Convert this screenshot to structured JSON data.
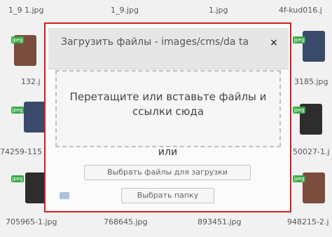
{
  "background": {
    "filenames": [
      "1_9 1.jpg",
      "1_9.jpg",
      "1.jpg",
      "4f-kud016.j",
      "132.j",
      "3185.jpg",
      "74259-115",
      "50027-1.j",
      "705965-1.jpg",
      "768645.jpg",
      "893451.jpg",
      "948215-2.j"
    ],
    "tag_label": "jpeg"
  },
  "dialog": {
    "title": "Загрузить файлы - images/cms/da ta",
    "close_glyph": "×",
    "drop_text": "Перетащите или вставьте файлы и ссылки сюда",
    "or_text": "или",
    "choose_files_label": "Выбрать файлы для загрузки",
    "choose_folder_label": "Выбрать папку"
  },
  "colors": {
    "highlight_border": "#d11f1f",
    "tag_green": "#3aa84a"
  }
}
